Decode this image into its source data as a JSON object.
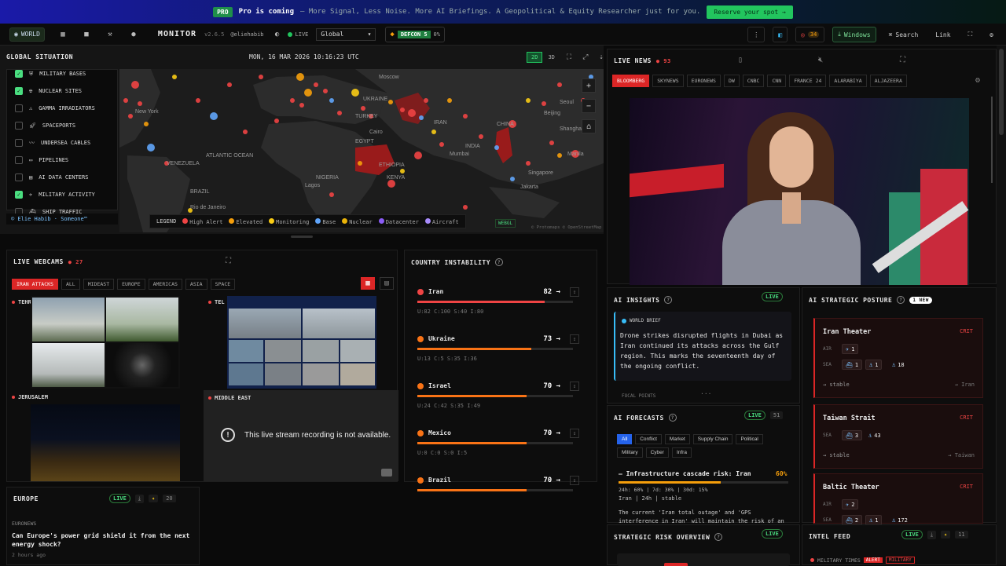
{
  "promo": {
    "badge": "PRO",
    "headline": "Pro is coming",
    "subtitle": "– More Signal, Less Noise. More AI Briefings. A Geopolitical & Equity Researcher just for you.",
    "cta": "Reserve your spot →"
  },
  "nav": {
    "world_label": "WORLD",
    "brand": "MONITOR",
    "version": "v2.6.5",
    "user": "@eliehabib",
    "live": "LIVE",
    "region": "Global",
    "defcon": "DEFCON 5",
    "defcon_pct": "0%",
    "alerts_count": "34",
    "windows": "Windows",
    "search": "Search",
    "link": "Link"
  },
  "map": {
    "title": "GLOBAL SITUATION",
    "timestamp": "MON, 16 MAR 2026 10:16:23 UTC",
    "mode_2d": "2D",
    "mode_3d": "3D",
    "layers": [
      {
        "label": "MILITARY BASES",
        "checked": true,
        "icon": "military-base-icon"
      },
      {
        "label": "NUCLEAR SITES",
        "checked": true,
        "icon": "radiation-icon"
      },
      {
        "label": "GAMMA IRRADIATORS",
        "checked": false,
        "icon": "warning-icon"
      },
      {
        "label": "SPACEPORTS",
        "checked": false,
        "icon": "rocket-icon"
      },
      {
        "label": "UNDERSEA CABLES",
        "checked": false,
        "icon": "cable-icon"
      },
      {
        "label": "PIPELINES",
        "checked": false,
        "icon": "pipeline-icon"
      },
      {
        "label": "AI DATA CENTERS",
        "checked": false,
        "icon": "server-icon"
      },
      {
        "label": "MILITARY ACTIVITY",
        "checked": true,
        "icon": "plane-icon"
      },
      {
        "label": "SHIP TRAFFIC",
        "checked": false,
        "icon": "ship-icon"
      }
    ],
    "credit": "© Elie Habib · Someone™",
    "legend_title": "LEGEND",
    "legend": [
      {
        "label": "High Alert",
        "color": "#ef4444"
      },
      {
        "label": "Elevated",
        "color": "#f59e0b"
      },
      {
        "label": "Monitoring",
        "color": "#facc15"
      },
      {
        "label": "Base",
        "color": "#60a5fa"
      },
      {
        "label": "Nuclear",
        "color": "#eab308"
      },
      {
        "label": "Datacenter",
        "color": "#8b5cf6"
      },
      {
        "label": "Aircraft",
        "color": "#a78bfa"
      }
    ],
    "webgl": "WEBGL",
    "attribution": "© Protomaps © OpenStreetMap",
    "place_labels": [
      "Moscow",
      "UKRAINE",
      "Beijing",
      "Seoul",
      "CHINA",
      "TURKEY",
      "IRAN",
      "Cairo",
      "EGYPT",
      "Mumbai",
      "INDIA",
      "Shanghai",
      "Manila",
      "Singapore",
      "Jakarta",
      "KENYA",
      "ETHIOPIA",
      "BRAZIL",
      "Rio de Janeiro",
      "VENEZUELA",
      "New York",
      "ATLANTIC OCEAN",
      "NIGERIA",
      "Lagos"
    ]
  },
  "webcams": {
    "title": "LIVE WEBCAMS",
    "count": "27",
    "tabs": [
      "IRAN ATTACKS",
      "ALL",
      "MIDEAST",
      "EUROPE",
      "AMERICAS",
      "ASIA",
      "SPACE"
    ],
    "cams": [
      "TEHRAN",
      "TEL AVIV",
      "JERUSALEM",
      "MIDDLE EAST"
    ],
    "unavailable": "This live stream recording is not available."
  },
  "instability": {
    "title": "COUNTRY INSTABILITY",
    "rows": [
      {
        "name": "Iran",
        "score": "82",
        "trend": "→",
        "sub": "U:82  C:100  S:40  I:80",
        "color": "#ef4444",
        "level": 0.82
      },
      {
        "name": "Ukraine",
        "score": "73",
        "trend": "→",
        "sub": "U:13  C:5  S:35  I:36",
        "color": "#f97316",
        "level": 0.73
      },
      {
        "name": "Israel",
        "score": "70",
        "trend": "→",
        "sub": "U:24  C:42  S:35  I:49",
        "color": "#f97316",
        "level": 0.7
      },
      {
        "name": "Mexico",
        "score": "70",
        "trend": "→",
        "sub": "U:0  C:0  S:0  I:5",
        "color": "#f97316",
        "level": 0.7
      },
      {
        "name": "Brazil",
        "score": "70",
        "trend": "→",
        "sub": "",
        "color": "#f97316",
        "level": 0.7
      }
    ]
  },
  "europe": {
    "title": "EUROPE",
    "live": "LIVE",
    "count": "20",
    "source": "EURONEWS",
    "headline": "Can Europe's power grid shield it from the next energy shock?",
    "time": "2 hours ago"
  },
  "news": {
    "title": "LIVE NEWS",
    "count": "93",
    "sources": [
      "BLOOMBERG",
      "SKYNEWS",
      "EURONEWS",
      "DW",
      "CNBC",
      "CNN",
      "FRANCE 24",
      "ALARABIYA",
      "ALJAZEERA"
    ]
  },
  "insights": {
    "title": "AI INSIGHTS",
    "live": "LIVE",
    "brief_label": "WORLD BRIEF",
    "brief": "Drone strikes disrupted flights in Dubai as Iran continued its attacks across the Gulf region. This marks the seventeenth day of the ongoing conflict.",
    "focal": "FOCAL POINTS"
  },
  "forecasts": {
    "title": "AI FORECASTS",
    "live": "LIVE",
    "count": "51",
    "tabs": [
      "All",
      "Conflict",
      "Market",
      "Supply Chain",
      "Political",
      "Military",
      "Cyber",
      "Infra"
    ],
    "item_title": "— Infrastructure cascade risk: Iran",
    "item_pct": "60%",
    "item_level": 0.6,
    "item_stats": "24h: 60% | 7d: 30% | 30d: 15%",
    "item_meta": "Iran | 24h | stable",
    "item_body": "The current 'Iran total outage' and 'GPS interference in Iran' will maintain the risk of an"
  },
  "posture": {
    "title": "AI STRATEGIC POSTURE",
    "new_badge": "1 NEW",
    "theaters": [
      {
        "name": "Iran Theater",
        "status": "CRIT",
        "air_label": "AIR",
        "air": [
          "1"
        ],
        "sea_label": "SEA",
        "sea": [
          "1",
          "1",
          "18"
        ],
        "trend": "→ stable",
        "region": "→ Iran"
      },
      {
        "name": "Taiwan Strait",
        "status": "CRIT",
        "air_label": "",
        "air": [],
        "sea_label": "SEA",
        "sea": [
          "3",
          "43"
        ],
        "trend": "→ stable",
        "region": "→ Taiwan"
      },
      {
        "name": "Baltic Theater",
        "status": "CRIT",
        "air_label": "AIR",
        "air": [
          "2"
        ],
        "sea_label": "SEA",
        "sea": [
          "2",
          "1",
          "172"
        ],
        "trend": "",
        "region": ""
      }
    ]
  },
  "strategic_risk": {
    "title": "STRATEGIC RISK OVERVIEW",
    "live": "LIVE"
  },
  "intel": {
    "title": "INTEL FEED",
    "live": "LIVE",
    "count": "11",
    "source": "MILITARY TIMES",
    "tag1": "ALERT",
    "tag2": "MILITARY"
  }
}
